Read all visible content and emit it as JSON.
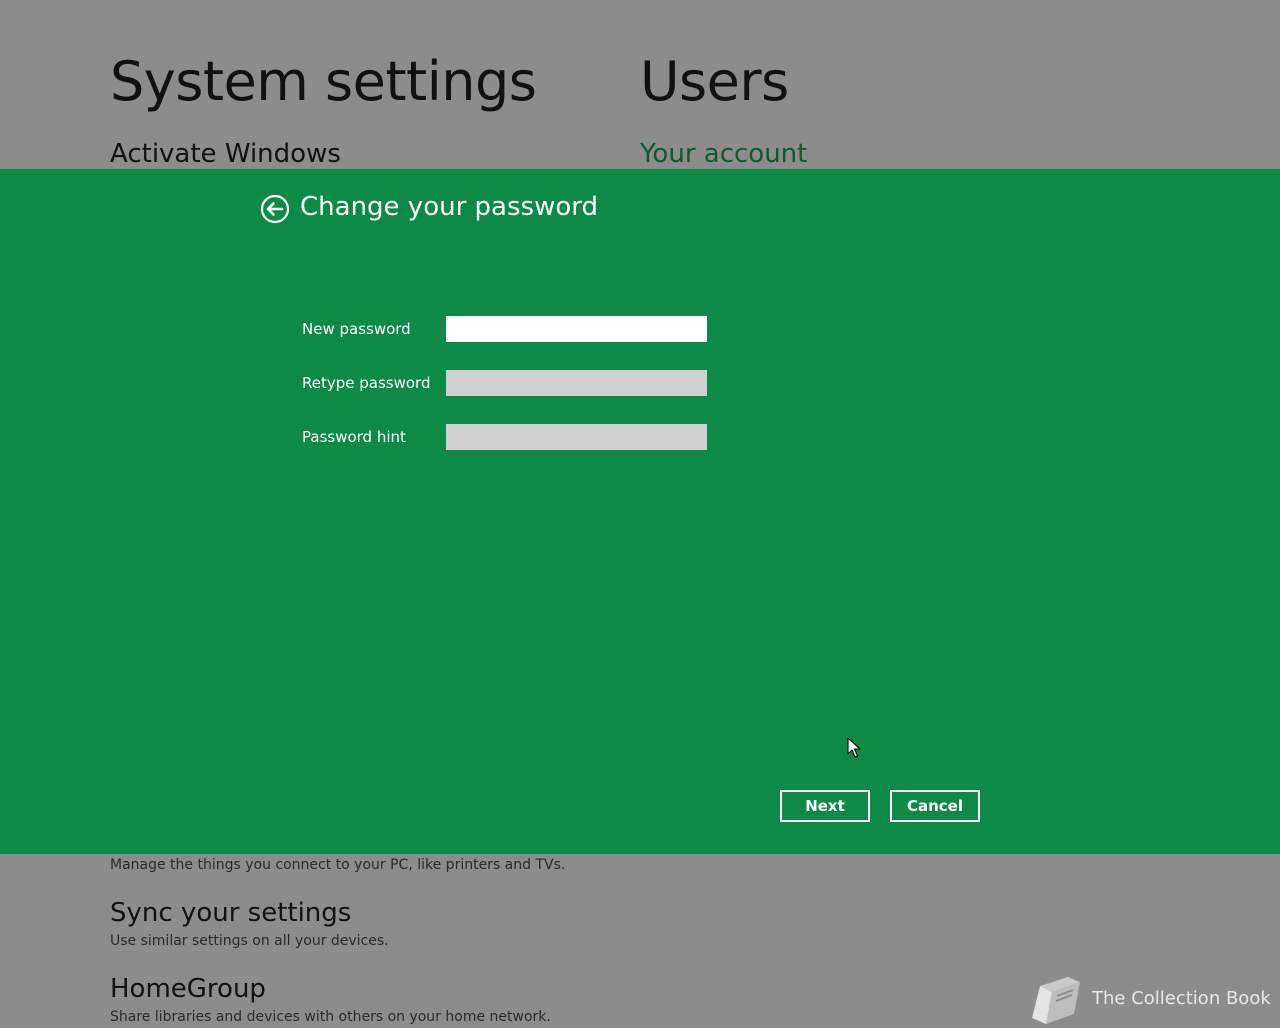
{
  "background": {
    "left_column": {
      "title": "System settings",
      "subhead": "Activate Windows"
    },
    "right_column": {
      "title": "Users",
      "subhead": "Your account"
    },
    "items": [
      {
        "title": "",
        "description": "Manage the things you connect to your PC, like printers and TVs."
      },
      {
        "title": "Sync your settings",
        "description": "Use similar settings on all your devices."
      },
      {
        "title": "HomeGroup",
        "description": "Share libraries and devices with others on your home network."
      }
    ]
  },
  "dialog": {
    "title": "Change your password",
    "fields": [
      {
        "label": "New password",
        "value": ""
      },
      {
        "label": "Retype password",
        "value": ""
      },
      {
        "label": "Password hint",
        "value": ""
      }
    ],
    "next_label": "Next",
    "cancel_label": "Cancel"
  },
  "watermark": {
    "text": "The Collection Book"
  },
  "colors": {
    "dialog_background": "#0e8a47",
    "page_background": "#8c8c8c",
    "accent_green_text": "#0f5a2c",
    "active_field": "#ffffff",
    "inactive_field": "#d1d0d0"
  },
  "icons": {
    "back": "back-arrow-circle-icon",
    "cursor": "mouse-pointer-icon",
    "watermark": "book-icon"
  }
}
